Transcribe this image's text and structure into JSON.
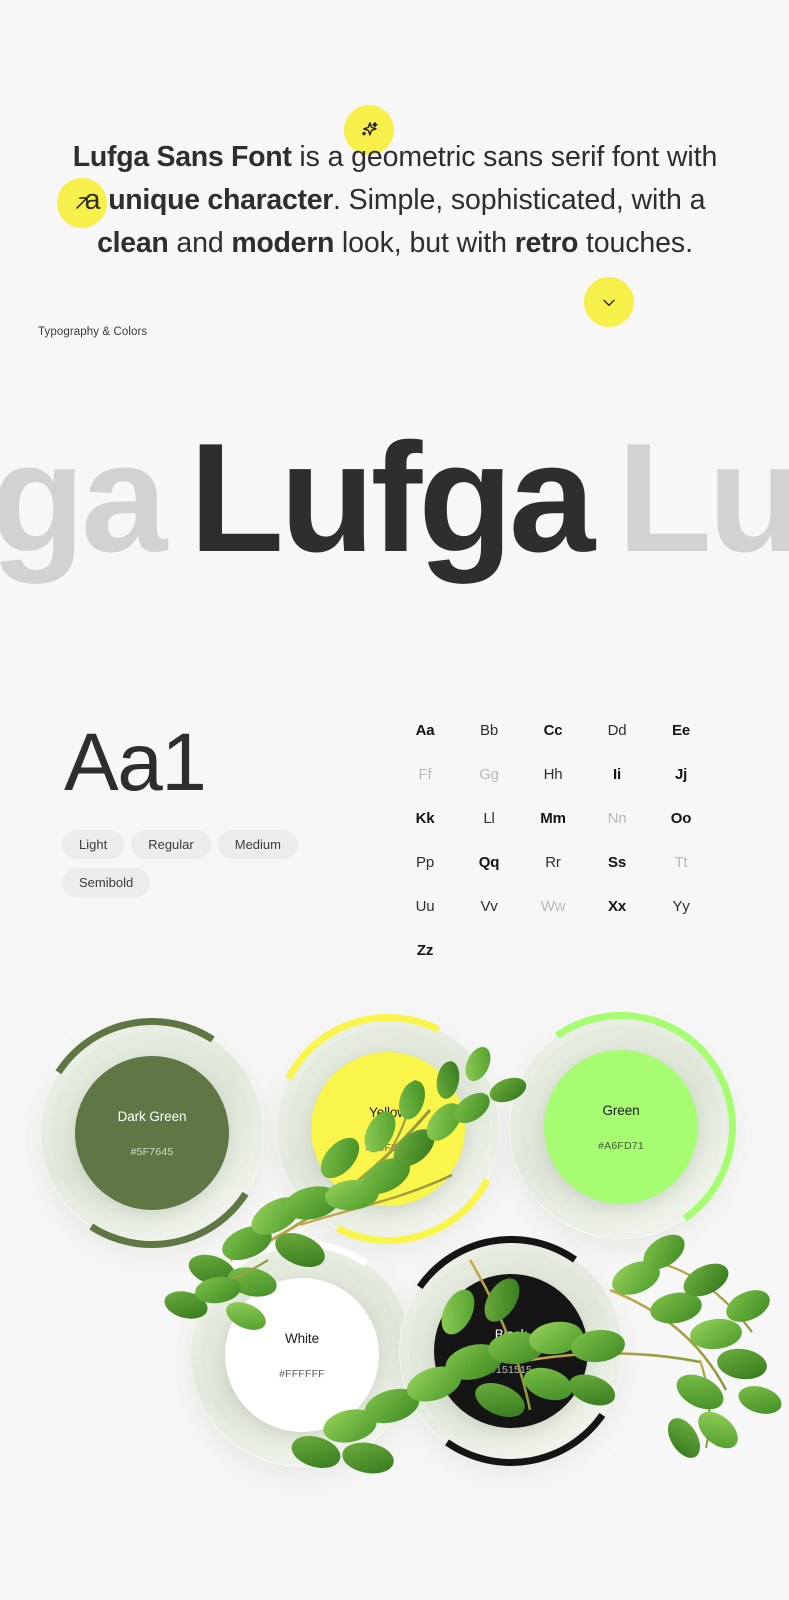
{
  "hero": {
    "headline_parts": [
      {
        "text": "Lufga Sans Font",
        "bold": true
      },
      {
        "text": " is a geometric sans serif font with a ",
        "bold": false
      },
      {
        "text": "unique character",
        "bold": true
      },
      {
        "text": ". Simple, sophisticated, with a ",
        "bold": false
      },
      {
        "text": "clean",
        "bold": true
      },
      {
        "text": " and ",
        "bold": false
      },
      {
        "text": "modern",
        "bold": true
      },
      {
        "text": " look, but with ",
        "bold": false
      },
      {
        "text": "retro",
        "bold": true
      },
      {
        "text": " touches.",
        "bold": false
      }
    ],
    "caption": "Typography & Colors",
    "badges": [
      {
        "name": "sparkles-icon",
        "color": "#F7EF4A"
      },
      {
        "name": "arrow-up-right-icon",
        "color": "#F7EF4A"
      },
      {
        "name": "check-icon",
        "color": "#F7EF4A"
      }
    ]
  },
  "wordmark": {
    "ghost_left": "ga",
    "main": "Lufga",
    "ghost_right": "Lu",
    "main_color": "#2E2E2E",
    "ghost_color": "#D2D2D2"
  },
  "specimen": {
    "sample": "Aa1",
    "weights": [
      "Light",
      "Regular",
      "Medium",
      "Semibold"
    ],
    "alphabet": [
      {
        "pair": "Aa",
        "weight": "bold"
      },
      {
        "pair": "Bb",
        "weight": "regular"
      },
      {
        "pair": "Cc",
        "weight": "bold"
      },
      {
        "pair": "Dd",
        "weight": "regular"
      },
      {
        "pair": "Ee",
        "weight": "bold"
      },
      {
        "pair": "Ff",
        "weight": "light"
      },
      {
        "pair": "Gg",
        "weight": "light"
      },
      {
        "pair": "Hh",
        "weight": "regular"
      },
      {
        "pair": "Ii",
        "weight": "bold"
      },
      {
        "pair": "Jj",
        "weight": "bold"
      },
      {
        "pair": "Kk",
        "weight": "bold"
      },
      {
        "pair": "Ll",
        "weight": "regular"
      },
      {
        "pair": "Mm",
        "weight": "bold"
      },
      {
        "pair": "Nn",
        "weight": "light"
      },
      {
        "pair": "Oo",
        "weight": "bold"
      },
      {
        "pair": "Pp",
        "weight": "regular"
      },
      {
        "pair": "Qq",
        "weight": "bold"
      },
      {
        "pair": "Rr",
        "weight": "regular"
      },
      {
        "pair": "Ss",
        "weight": "bold"
      },
      {
        "pair": "Tt",
        "weight": "light"
      },
      {
        "pair": "Uu",
        "weight": "regular"
      },
      {
        "pair": "Vv",
        "weight": "regular"
      },
      {
        "pair": "Ww",
        "weight": "light"
      },
      {
        "pair": "Xx",
        "weight": "bold"
      },
      {
        "pair": "Yy",
        "weight": "regular"
      },
      {
        "pair": "Zz",
        "weight": "bold"
      }
    ]
  },
  "palette": {
    "swatches": [
      {
        "name": "Dark Green",
        "hex": "#5F7645",
        "text_color": "#FFFFFF",
        "arc_color": "#5F7645"
      },
      {
        "name": "Yellow",
        "hex": "#F9F54B",
        "text_color": "#1A1A1A",
        "arc_color": "#F9F54B"
      },
      {
        "name": "Green",
        "hex": "#A6FD71",
        "text_color": "#1A1A1A",
        "arc_color": "#A6FD71"
      },
      {
        "name": "White",
        "hex": "#FFFFFF",
        "text_color": "#1A1A1A",
        "arc_color": "#FFFFFF"
      },
      {
        "name": "Black",
        "hex": "#151515",
        "text_color": "#FFFFFF",
        "arc_color": "#151515"
      }
    ]
  }
}
